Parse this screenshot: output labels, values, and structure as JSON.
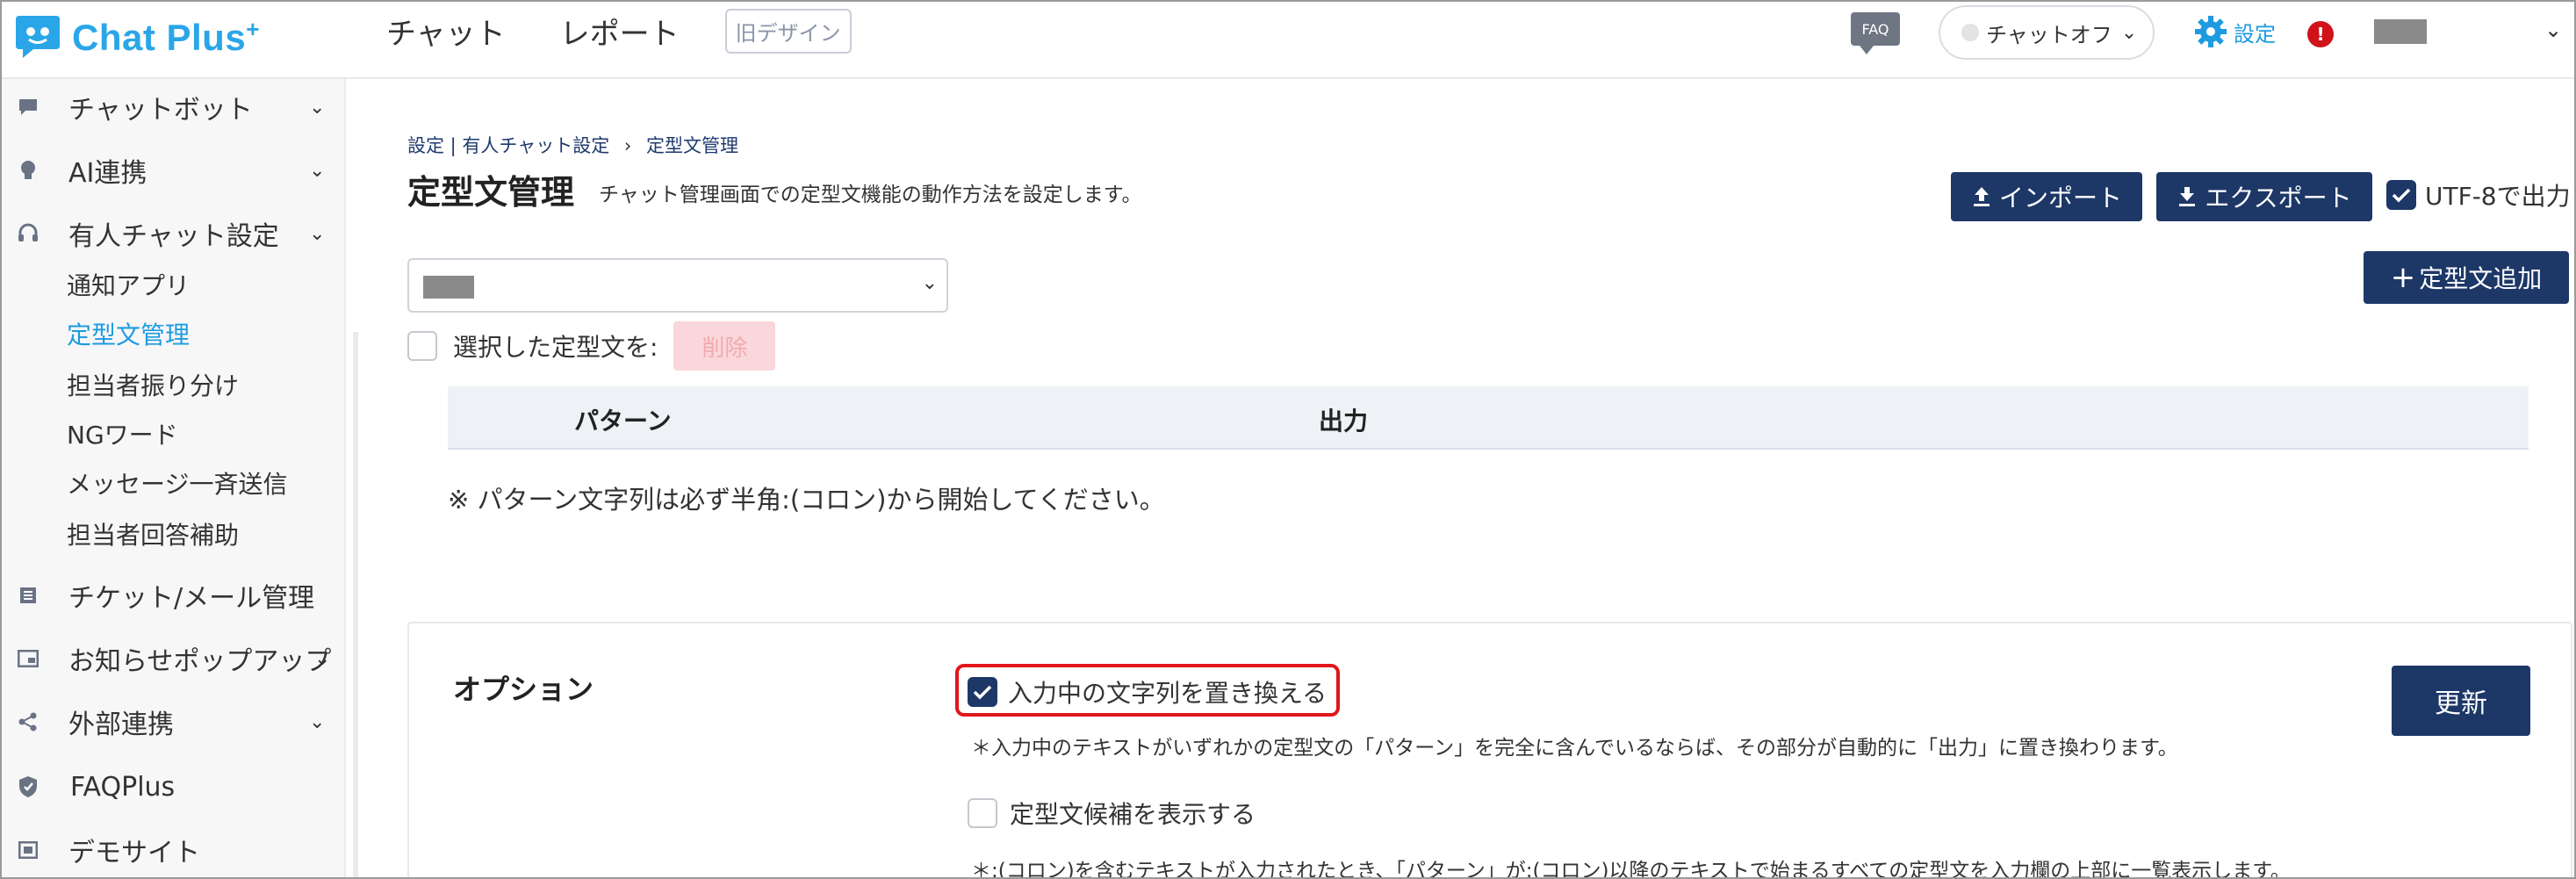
{
  "header": {
    "logo_text": "Chat Plus",
    "logo_sup": "+",
    "nav": [
      "チャット",
      "レポート"
    ],
    "old_design": "旧デザイン",
    "faq": "FAQ",
    "chat_status": "チャットオフ",
    "settings": "設定",
    "alert": "!"
  },
  "sidebar": {
    "items": [
      {
        "label": "チャットボット",
        "icon": "chat-bubble-icon",
        "chevron": true
      },
      {
        "label": "AI連携",
        "icon": "bulb-icon",
        "chevron": true
      },
      {
        "label": "有人チャット設定",
        "icon": "headset-icon",
        "chevron": true
      },
      {
        "label": "チケット/メール管理",
        "icon": "ticket-icon",
        "chevron": false
      },
      {
        "label": "お知らせポップアップ",
        "icon": "popup-icon",
        "chevron": true
      },
      {
        "label": "外部連携",
        "icon": "share-icon",
        "chevron": true
      },
      {
        "label": "FAQPlus",
        "icon": "shield-icon",
        "chevron": false
      },
      {
        "label": "デモサイト",
        "icon": "demo-icon",
        "chevron": false
      }
    ],
    "subitems": [
      "通知アプリ",
      "定型文管理",
      "担当者振り分け",
      "NGワード",
      "メッセージ一斉送信",
      "担当者回答補助"
    ],
    "active_subitem": "定型文管理"
  },
  "main": {
    "breadcrumb": {
      "part1": "設定 | 有人チャット設定",
      "sep": "›",
      "current": "定型文管理"
    },
    "title": "定型文管理",
    "description": "チャット管理画面での定型文機能の動作方法を設定します。",
    "import_label": "インポート",
    "export_label": "エクスポート",
    "utf8_label": "UTF-8で出力",
    "utf8_checked": true,
    "add_label": "定型文追加",
    "bulk_label": "選択した定型文を:",
    "delete_label": "削除",
    "table": {
      "columns": [
        "パターン",
        "出力"
      ]
    },
    "note": "※ パターン文字列は必ず半角:(コロン)から開始してください。"
  },
  "options": {
    "title": "オプション",
    "replace_label": "入力中の文字列を置き換える",
    "replace_checked": true,
    "replace_note": "＊入力中のテキストがいずれかの定型文の「パターン」を完全に含んでいるならば、その部分が自動的に「出力」に置き換わります。",
    "suggest_label": "定型文候補を表示する",
    "suggest_checked": false,
    "suggest_note": "＊:(コロン)を含むテキストが入力されたとき、「パターン」が:(コロン)以降のテキストで始まるすべての定型文を入力欄の上部に一覧表示します。",
    "update_label": "更新"
  },
  "colors": {
    "navy": "#1d3767",
    "accent": "#1e9be0",
    "highlight": "#e0161c"
  }
}
